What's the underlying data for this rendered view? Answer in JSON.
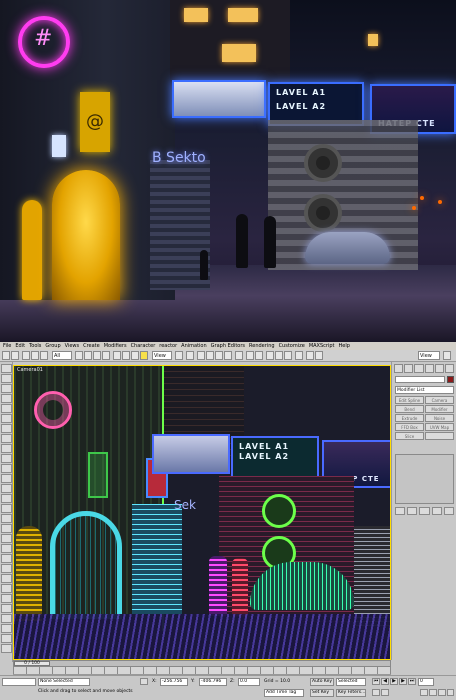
{
  "render": {
    "sign_level_1": "LAVEL A1",
    "sign_level_2": "LAVEL A2",
    "sign_hater": "HATEP CTE",
    "sector_text": "B Sekto"
  },
  "menubar": {
    "items": [
      "File",
      "Edit",
      "Tools",
      "Group",
      "Views",
      "Create",
      "Modifiers",
      "Character",
      "reactor",
      "Animation",
      "Graph Editors",
      "Rendering",
      "Customize",
      "MAXScript",
      "Help"
    ]
  },
  "toolbar": {
    "selection_filter": "All",
    "reference_coord": "View",
    "named_selection": "View"
  },
  "viewport": {
    "label": "Camera01",
    "sign_level_1": "LAVEL A1",
    "sign_level_2": "LAVEL A2",
    "sign_hater": "HATEP CTE",
    "sector_text": "Sek"
  },
  "command_panel": {
    "name_field": "",
    "modifier_list": "Modifier List",
    "buttons": [
      "Edit Spline",
      "Camera",
      "Bend",
      "Modifier",
      "Extrude",
      "Noise",
      "FFD Box",
      "UVW Map",
      "Slice",
      ""
    ]
  },
  "time_slider": {
    "frame_label": "0 / 100"
  },
  "status": {
    "selection": "None Selected",
    "prompt": "Click and drag to select and move objects",
    "x_value": "-256.756",
    "y_value": "-406.796",
    "z_value": "0.0",
    "grid": "Grid = 10.0",
    "auto_key": "Auto Key",
    "selected": "Selected",
    "set_key": "Set Key",
    "key_filters": "Key Filters...",
    "time_tag": "Add Time Tag",
    "frame": "0"
  }
}
